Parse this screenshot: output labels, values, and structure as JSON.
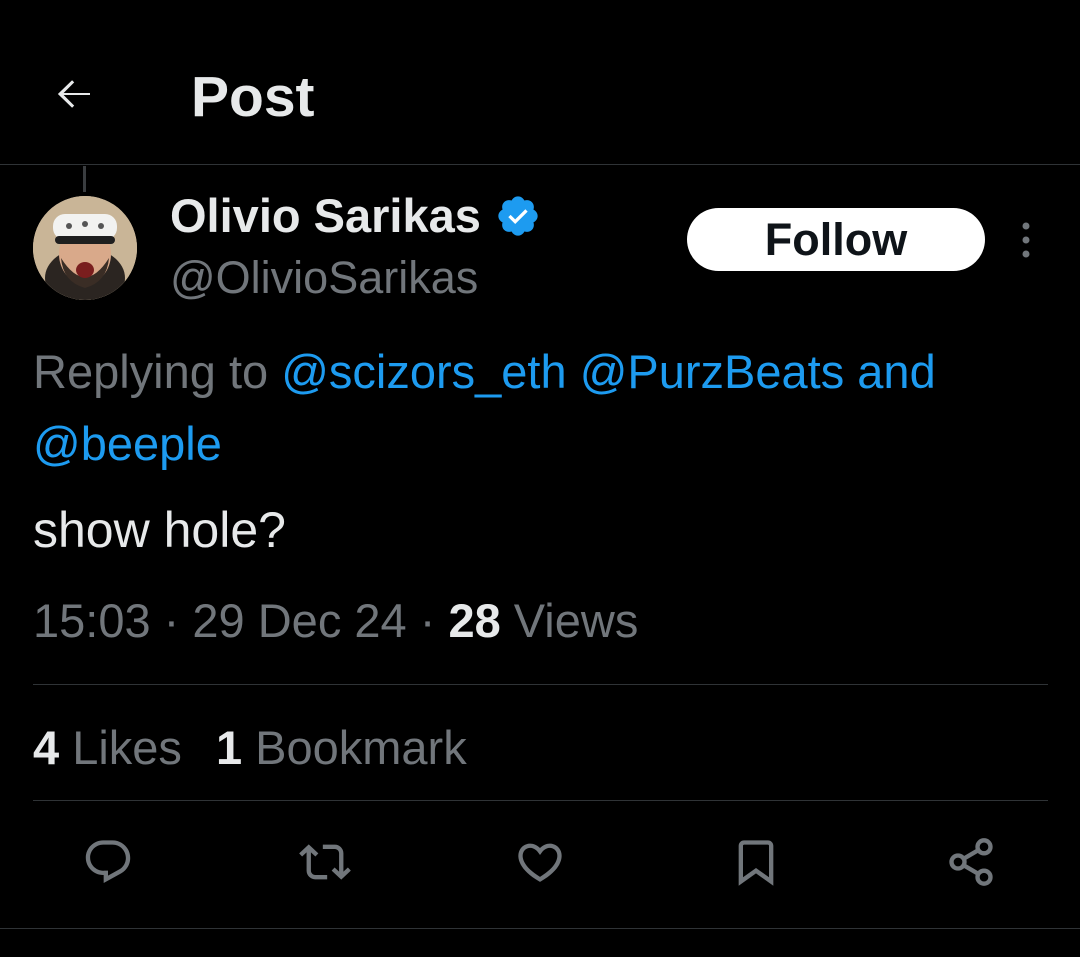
{
  "header": {
    "title": "Post",
    "back_icon": "arrow-left-icon"
  },
  "tweet": {
    "author_name": "Olivio Sarikas",
    "author_handle": "@OlivioSarikas",
    "verified": true,
    "follow_label": "Follow",
    "replying_prefix": "Replying to",
    "mentions": [
      "@scizors_eth",
      "@PurzBeats"
    ],
    "mention_joiner": "and",
    "mention_last": "@beeple",
    "text": "show hole?",
    "time": "15:03",
    "date": "29 Dec 24",
    "views_count": "28",
    "views_label": "Views",
    "likes_count": "4",
    "likes_label": "Likes",
    "bookmarks_count": "1",
    "bookmarks_label": "Bookmark"
  },
  "actions": [
    "reply-icon",
    "repost-icon",
    "like-icon",
    "bookmark-icon",
    "share-icon"
  ],
  "colors": {
    "background": "#000000",
    "text_primary": "#e7e9ea",
    "text_secondary": "#71767b",
    "accent": "#1d9bf0",
    "divider": "#2f3336",
    "follow_bg": "#ffffff"
  }
}
